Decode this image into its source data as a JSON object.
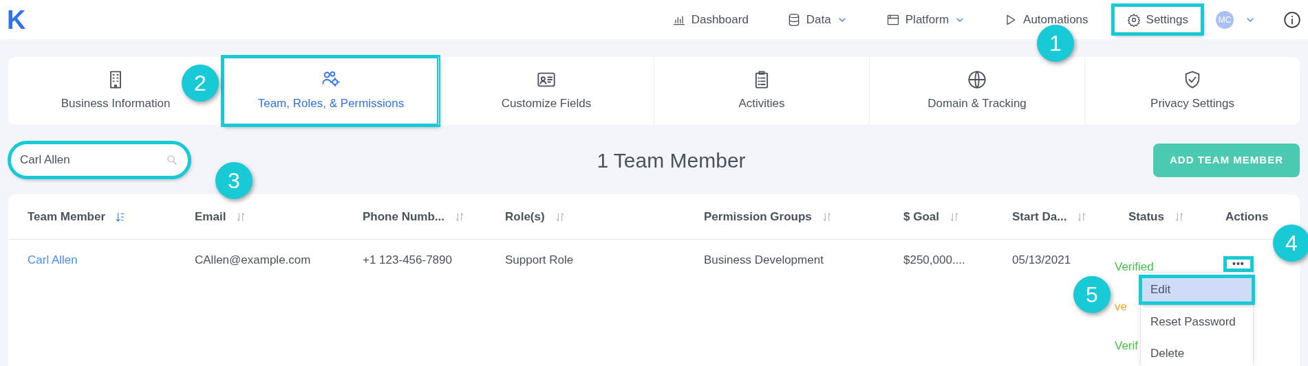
{
  "logo": "K",
  "nav": [
    {
      "label": "Dashboard",
      "dropdown": false,
      "highlighted": false
    },
    {
      "label": "Data",
      "dropdown": true,
      "highlighted": false
    },
    {
      "label": "Platform",
      "dropdown": true,
      "highlighted": false
    },
    {
      "label": "Automations",
      "dropdown": false,
      "highlighted": false
    },
    {
      "label": "Settings",
      "dropdown": false,
      "highlighted": true
    }
  ],
  "avatar": {
    "initials": "MC",
    "dropdown": true
  },
  "tabs": [
    {
      "label": "Business Information",
      "selected": false,
      "highlighted": false
    },
    {
      "label": "Team, Roles, & Permissions",
      "selected": true,
      "highlighted": true
    },
    {
      "label": "Customize Fields",
      "selected": false,
      "highlighted": false
    },
    {
      "label": "Activities",
      "selected": false,
      "highlighted": false
    },
    {
      "label": "Domain & Tracking",
      "selected": false,
      "highlighted": false
    },
    {
      "label": "Privacy Settings",
      "selected": false,
      "highlighted": false
    }
  ],
  "search": {
    "value": "Carl Allen",
    "highlighted": true
  },
  "heading": "1 Team Member",
  "add_button": "ADD TEAM MEMBER",
  "table": {
    "columns": [
      {
        "label": "Team Member",
        "sortable": true,
        "sorted": true
      },
      {
        "label": "Email",
        "sortable": true,
        "sorted": false
      },
      {
        "label": "Phone Numb...",
        "sortable": true,
        "sorted": false
      },
      {
        "label": "Role(s)",
        "sortable": true,
        "sorted": false
      },
      {
        "label": "Permission Groups",
        "sortable": true,
        "sorted": false
      },
      {
        "label": "$ Goal",
        "sortable": true,
        "sorted": false
      },
      {
        "label": "Start Da...",
        "sortable": true,
        "sorted": false
      },
      {
        "label": "Status",
        "sortable": true,
        "sorted": false
      },
      {
        "label": "Actions",
        "sortable": false,
        "sorted": false
      }
    ],
    "rows": [
      {
        "cells": [
          "Carl Allen",
          "CAllen@example.com",
          "+1 123-456-7890",
          "Support Role",
          "Business Development",
          "$250,000....",
          "05/13/2021"
        ],
        "statuses": [
          {
            "text": "Verified",
            "color": "#45c245"
          },
          {
            "text": "ve",
            "color": "#f5a623"
          },
          {
            "text": "Verif",
            "color": "#45c245"
          }
        ],
        "actions": {
          "label": "•••",
          "highlighted": true
        }
      }
    ]
  },
  "menu": [
    {
      "label": "Edit",
      "selected": true,
      "highlighted": true
    },
    {
      "label": "Reset Password",
      "selected": false,
      "highlighted": false
    },
    {
      "label": "Delete",
      "selected": false,
      "highlighted": false
    }
  ],
  "callouts": [
    {
      "number": "1"
    },
    {
      "number": "2"
    },
    {
      "number": "3"
    },
    {
      "number": "4"
    },
    {
      "number": "5"
    }
  ]
}
